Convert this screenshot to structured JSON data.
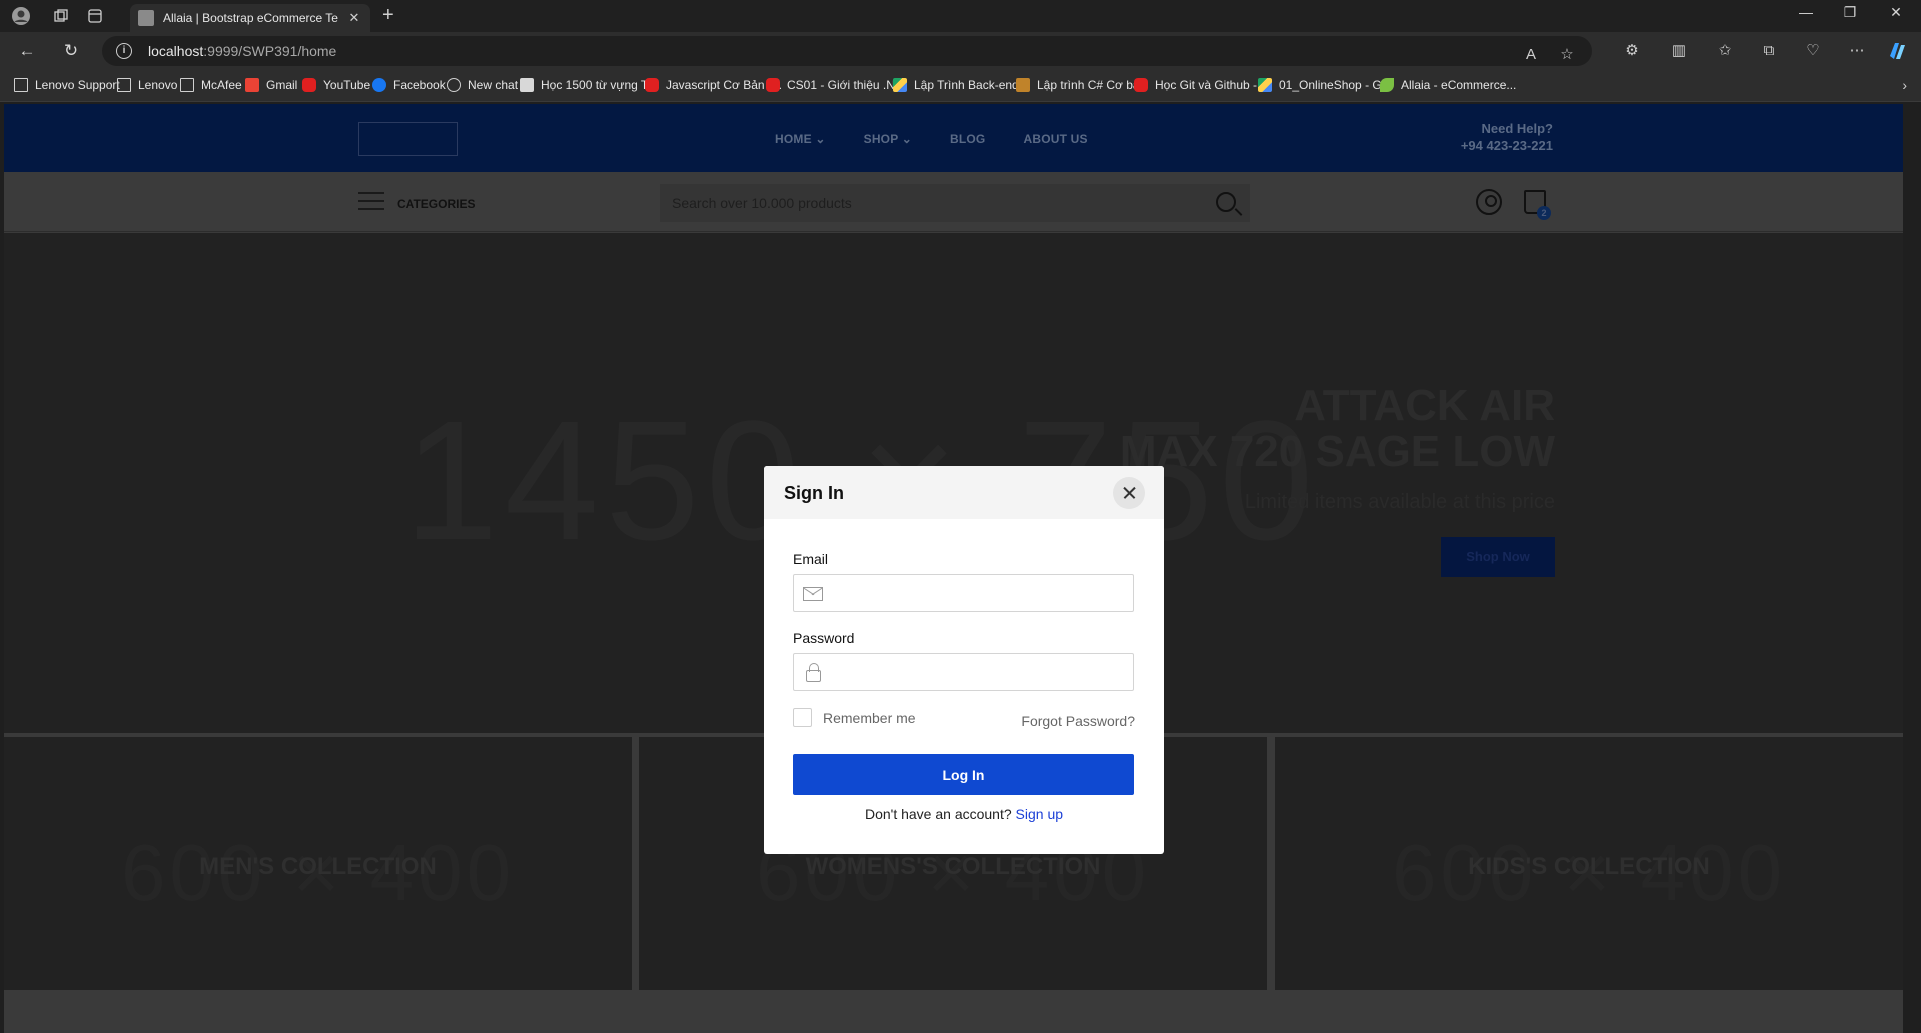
{
  "browser": {
    "tab_title": "Allaia | Bootstrap eCommerce Te",
    "url_host": "localhost",
    "url_path": ":9999/SWP391/home",
    "bookmarks": [
      {
        "label": "Lenovo Support",
        "icon": "doc"
      },
      {
        "label": "Lenovo",
        "icon": "doc"
      },
      {
        "label": "McAfee",
        "icon": "doc"
      },
      {
        "label": "Gmail",
        "icon": "gm"
      },
      {
        "label": "YouTube",
        "icon": "yt"
      },
      {
        "label": "Facebook",
        "icon": "fb"
      },
      {
        "label": "New chat",
        "icon": "oai"
      },
      {
        "label": "Học 1500 từ vựng T...",
        "icon": "tt"
      },
      {
        "label": "Javascript Cơ Bản -...",
        "icon": "yt"
      },
      {
        "label": "CS01 - Giới thiệu .N...",
        "icon": "yt"
      },
      {
        "label": "Lập Trình Back-end...",
        "icon": "drive"
      },
      {
        "label": "Lập trình C# Cơ bản",
        "icon": "csh"
      },
      {
        "label": "Học Git và Github -...",
        "icon": "yt"
      },
      {
        "label": "01_OnlineShop - G...",
        "icon": "drive"
      },
      {
        "label": "Allaia - eCommerce...",
        "icon": "leaf"
      }
    ]
  },
  "header": {
    "nav": [
      "HOME",
      "SHOP",
      "BLOG",
      "ABOUT US"
    ],
    "help_title": "Need Help?",
    "help_phone": "+94 423-23-221",
    "categories_label": "CATEGORIES",
    "search_placeholder": "Search over 10.000 products",
    "cart_count": "2"
  },
  "hero": {
    "placeholder": "1450 × 750",
    "title_line1": "ATTACK AIR",
    "title_line2": "MAX 720 SAGE LOW",
    "subtitle": "Limited items available at this price",
    "button": "Shop Now"
  },
  "tiles": [
    {
      "placeholder": "600 × 400",
      "label": "MEN'S COLLECTION"
    },
    {
      "placeholder": "600 × 400",
      "label": "WOMENS'S COLLECTION"
    },
    {
      "placeholder": "600 × 400",
      "label": "KIDS'S COLLECTION"
    }
  ],
  "modal": {
    "title": "Sign In",
    "email_label": "Email",
    "password_label": "Password",
    "remember_label": "Remember me",
    "forgot_label": "Forgot Password?",
    "login_button": "Log In",
    "signup_prompt": "Don't have an account?",
    "signup_link": "Sign up"
  }
}
